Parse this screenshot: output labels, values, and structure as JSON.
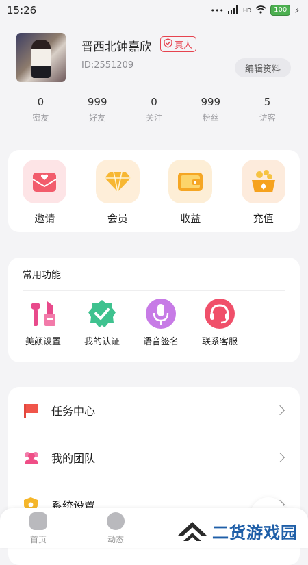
{
  "status_bar": {
    "time": "15:26",
    "battery": "100",
    "network": "HD"
  },
  "profile": {
    "name": "晋西北钟嘉欣",
    "badge": "真人",
    "id": "ID:2551209",
    "edit_label": "编辑资料"
  },
  "stats": [
    {
      "value": "0",
      "label": "密友"
    },
    {
      "value": "999",
      "label": "好友"
    },
    {
      "value": "0",
      "label": "关注"
    },
    {
      "value": "999",
      "label": "粉丝"
    },
    {
      "value": "5",
      "label": "访客"
    }
  ],
  "quick_actions": [
    {
      "label": "邀请",
      "icon": "invite-envelope-icon",
      "color": "#f25c6c"
    },
    {
      "label": "会员",
      "icon": "diamond-icon",
      "color": "#f7b733"
    },
    {
      "label": "收益",
      "icon": "wallet-icon",
      "color": "#f5a623"
    },
    {
      "label": "充值",
      "icon": "coin-pot-icon",
      "color": "#f6a21e"
    }
  ],
  "common_functions": {
    "title": "常用功能",
    "items": [
      {
        "label": "美颜设置",
        "icon": "cosmetics-icon",
        "color": "#e84a8b"
      },
      {
        "label": "我的认证",
        "icon": "verified-check-icon",
        "color": "#3fc28f"
      },
      {
        "label": "语音签名",
        "icon": "microphone-icon",
        "color": "#c77be6"
      },
      {
        "label": "联系客服",
        "icon": "headset-icon",
        "color": "#f0506a"
      }
    ]
  },
  "menu": [
    {
      "label": "任务中心",
      "icon": "flag-icon",
      "color": "#f0554a"
    },
    {
      "label": "我的团队",
      "icon": "team-icon",
      "color": "#ef4e86"
    },
    {
      "label": "系统设置",
      "icon": "settings-shield-icon",
      "color": "#f5b62a"
    }
  ],
  "tabbar": [
    {
      "label": "首页",
      "icon": "home-icon"
    },
    {
      "label": "动态",
      "icon": "compass-icon"
    }
  ],
  "watermark": {
    "text": "二货游戏园"
  }
}
